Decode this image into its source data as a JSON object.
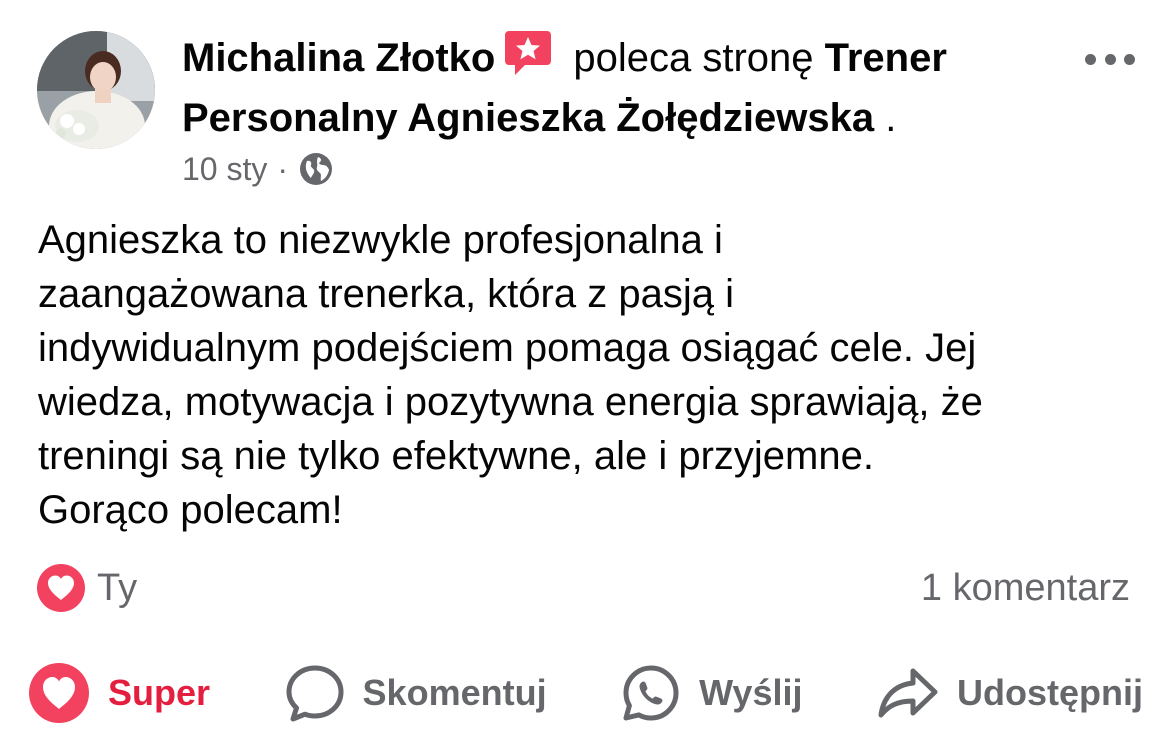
{
  "post": {
    "author": "Michalina Złotko",
    "verb": "poleca stronę",
    "page_name": "Trener Personalny Agnieszka Żołędziewska",
    "page_suffix": " .",
    "date": "10 sty",
    "separator": "·",
    "privacy_icon": "globe-icon",
    "text": "Agnieszka to niezwykle profesjonalna i\nzaangażowana trenerka, która z pasją i\nindywidualnym podejściem pomaga osiągać cele. Jej\nwiedza, motywacja i pozytywna energia sprawiają, że\ntreningi są nie tylko efektywne, ale i przyjemne.\nGorąco polecam!"
  },
  "reactions": {
    "icon": "love-reaction-icon",
    "label": "Ty",
    "comments": "1 komentarz"
  },
  "actions": [
    {
      "label": "Super",
      "icon": "heart-icon",
      "active": true
    },
    {
      "label": "Skomentuj",
      "icon": "comment-icon",
      "active": false
    },
    {
      "label": "Wyślij",
      "icon": "whatsapp-icon",
      "active": false
    },
    {
      "label": "Udostępnij",
      "icon": "share-icon",
      "active": false
    }
  ],
  "colors": {
    "love_red": "#f3425f",
    "active_red": "#e41e3f",
    "secondary_text": "#65676b",
    "primary_text": "#050505"
  }
}
